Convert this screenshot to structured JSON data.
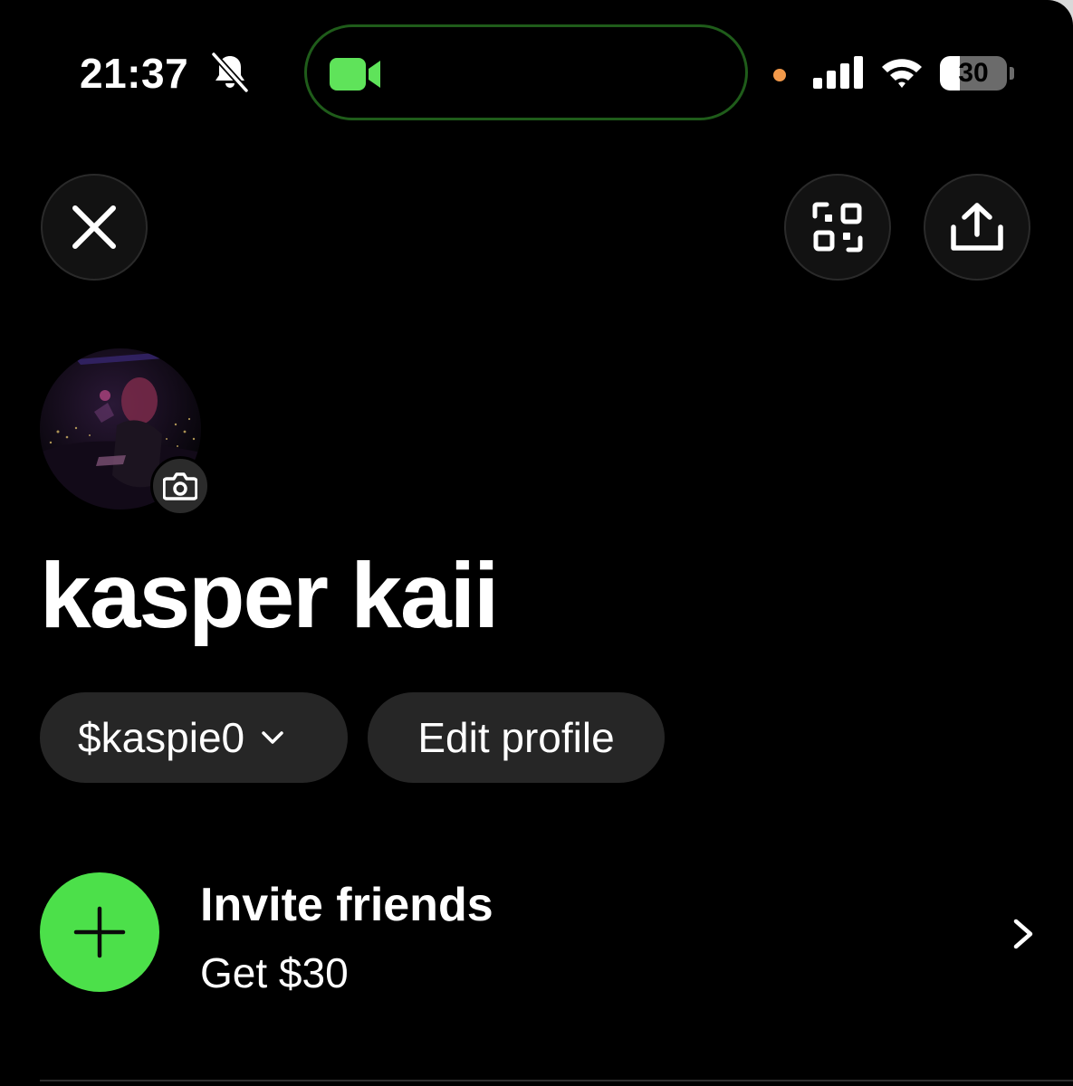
{
  "status_bar": {
    "time": "21:37",
    "battery_percent": "30",
    "battery_level": 0.3,
    "icons": [
      "bell-slash-icon",
      "video-camera-icon",
      "cellular-signal-icon",
      "wifi-icon",
      "battery-icon"
    ],
    "camera_indicator_color": "#5fe35a",
    "privacy_dot_color": "#f2994a"
  },
  "header": {
    "close_icon": "close-icon",
    "qr_icon": "qr-code-icon",
    "share_icon": "share-icon"
  },
  "profile": {
    "avatar_description_icon": "avatar-photo",
    "camera_badge_icon": "camera-icon",
    "display_name": "kasper kaii",
    "cashtag": "$kaspie0",
    "edit_label": "Edit profile"
  },
  "invite": {
    "title": "Invite friends",
    "subtitle": "Get $30",
    "icon": "plus-icon",
    "accent_color": "#4ce04a"
  }
}
